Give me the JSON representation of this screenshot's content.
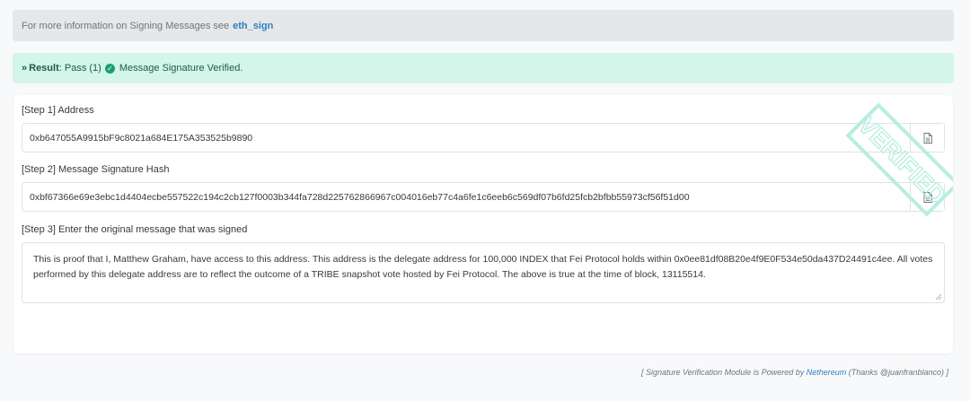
{
  "info": {
    "text": "For more information on Signing Messages see",
    "link_label": "eth_sign"
  },
  "result": {
    "label": "Result",
    "status": ": Pass (1)",
    "message": "Message Signature Verified."
  },
  "steps": {
    "address_label": "[Step 1] Address",
    "address_value": "0xb647055A9915bF9c8021a684E175A353525b9890",
    "hash_label": "[Step 2] Message Signature Hash",
    "hash_value": "0xbf67366e69e3ebc1d4404ecbe557522c194c2cb127f0003b344fa728d225762866967c004016eb77c4a6fe1c6eeb6c569df07b6fd25fcb2bfbb55973cf56f51d00",
    "message_label": "[Step 3] Enter the original message that was signed",
    "message_value": "This is proof that I, Matthew Graham, have access to this address. This address is the delegate address for 100,000 INDEX that Fei Protocol holds within 0x0ee81df08B20e4f9E0F534e50da437D24491c4ee. All votes performed by this delegate address are to reflect the outcome of a TRIBE snapshot vote hosted by Fei Protocol. The above is true at the time of block, 13115514."
  },
  "watermark": {
    "text": "VERIFIED",
    "color": "#b8ede0"
  },
  "footer": {
    "prefix": "[ Signature Verification Module is Powered by",
    "link_label": "Nethereum",
    "suffix": "(Thanks @juanfranblanco) ]"
  },
  "colors": {
    "info_bg": "#e6e7ea",
    "result_bg": "#d4f5ea",
    "link": "#2f7fc1",
    "success": "#1a9e73"
  }
}
